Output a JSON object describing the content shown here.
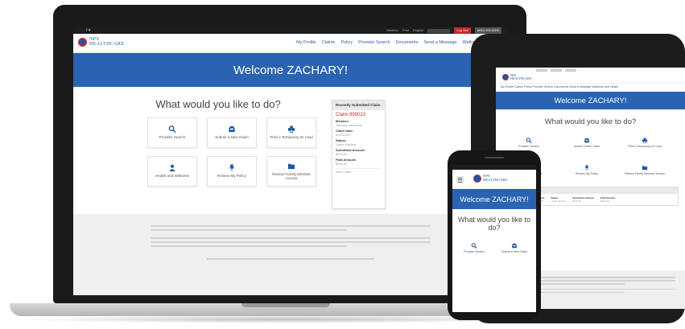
{
  "brand": {
    "name_line1": "NPS",
    "name_line2": "HEALTHCARE",
    "primary_color": "#2a63b1",
    "accent_color": "#c62828"
  },
  "laptop": {
    "utility": {
      "social": "f  ♥",
      "links": [
        "Member",
        "Print",
        "English"
      ],
      "login_button": "Log Out",
      "phone_button": "(800) 000-0000"
    },
    "nav": [
      "My Profile",
      "Claims",
      "Policy",
      "Provider Search",
      "Documents",
      "Send a Message",
      "Wellness and Health"
    ],
    "hero_title": "Welcome ZACHARY!",
    "main_title": "What would you like to do?",
    "tiles": [
      {
        "icon": "search-icon",
        "label": "Provider Search"
      },
      {
        "icon": "inbox-icon",
        "label": "Submit a New Claim"
      },
      {
        "icon": "printer-icon",
        "label": "Print a Temporary ID Card"
      },
      {
        "icon": "user-icon",
        "label": "Health and Wellness"
      },
      {
        "icon": "pin-icon",
        "label": "Review My Policy"
      },
      {
        "icon": "folder-icon",
        "label": "Review Family Member Access"
      }
    ],
    "claim": {
      "heading": "Recently Submitted Claim",
      "id": "Claim 899013",
      "fields": [
        {
          "label": "Member:",
          "value": "Zachary Lastname"
        },
        {
          "label": "Claim Date:",
          "value": "00/00/2017"
        },
        {
          "label": "Status:",
          "value": "Under Review"
        },
        {
          "label": "Submitted Amount:",
          "value": "$130.00"
        },
        {
          "label": "Paid Amount:",
          "value": "$000.00"
        }
      ],
      "link": "View Claim"
    }
  },
  "tablet": {
    "hero_title": "Welcome ZACHARY!",
    "main_title": "What would you like to do?",
    "nav_text": "My Profile  Claims  Policy  Provider Search  Documents  Send a Message  Wellness and Health",
    "tiles": [
      {
        "icon": "search-icon",
        "label": "Provider Search"
      },
      {
        "icon": "inbox-icon",
        "label": "Submit a New Claim"
      },
      {
        "icon": "printer-icon",
        "label": "Print a Temporary ID Card"
      },
      {
        "icon": "user-icon",
        "label": "Health and Wellness"
      },
      {
        "icon": "pin-icon",
        "label": "Review My Policy"
      },
      {
        "icon": "folder-icon",
        "label": "Review Family Member Access"
      }
    ],
    "claim": {
      "heading": "Recently Submitted Claim",
      "columns": [
        {
          "label": "Member",
          "value": "Zachary Lastname"
        },
        {
          "label": "Claim Date",
          "value": "00/00/2017"
        },
        {
          "label": "Status",
          "value": "Under Review"
        },
        {
          "label": "Submitted Amount",
          "value": "$130.00"
        },
        {
          "label": "Paid Amount",
          "value": "$000.00"
        }
      ]
    }
  },
  "phone": {
    "hero_title": "Welcome ZACHARY!",
    "main_title": "What would you like to do?",
    "tiles": [
      {
        "icon": "search-icon",
        "label": "Provider Search"
      },
      {
        "icon": "inbox-icon",
        "label": "Submit a New Claim"
      }
    ]
  }
}
